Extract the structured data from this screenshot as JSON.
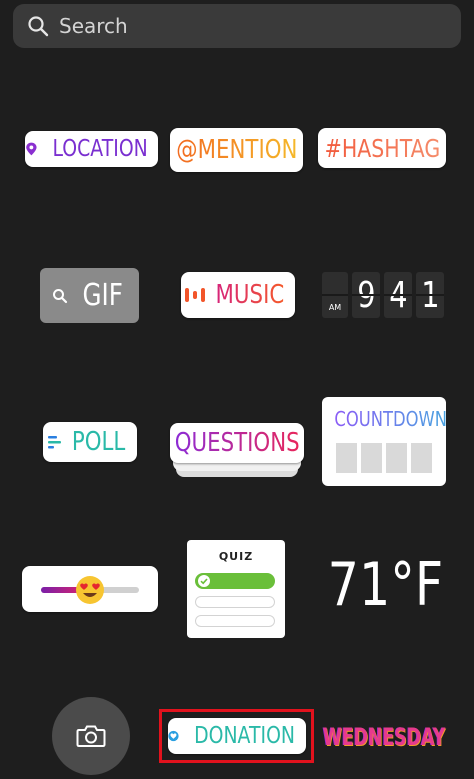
{
  "search": {
    "placeholder": "Search"
  },
  "stickers": {
    "location": {
      "label": "LOCATION",
      "icon": "location-pin-icon",
      "color": "#7a2fd0"
    },
    "mention": {
      "label": "@MENTION"
    },
    "hashtag": {
      "label": "#HASHTAG"
    },
    "gif": {
      "label": "GIF",
      "icon": "search-icon"
    },
    "music": {
      "label": "MUSIC",
      "icon": "music-bars-icon"
    },
    "clock": {
      "ampm": "AM",
      "digits": [
        "9",
        "4",
        "1"
      ]
    },
    "poll": {
      "label": "POLL",
      "icon": "poll-lines-icon"
    },
    "questions": {
      "label": "QUESTIONS"
    },
    "countdown": {
      "label": "COUNTDOWN"
    },
    "slider": {
      "emoji": "heart-eyes-emoji",
      "value": 0.49
    },
    "quiz": {
      "label": "QUIZ"
    },
    "temperature": {
      "label": "71°F"
    },
    "donation": {
      "label": "DONATION",
      "icon": "heart-badge-icon"
    },
    "day": {
      "label": "WEDNESDAY"
    }
  },
  "camera": {
    "icon": "camera-icon"
  },
  "highlight_color": "#e2121d"
}
